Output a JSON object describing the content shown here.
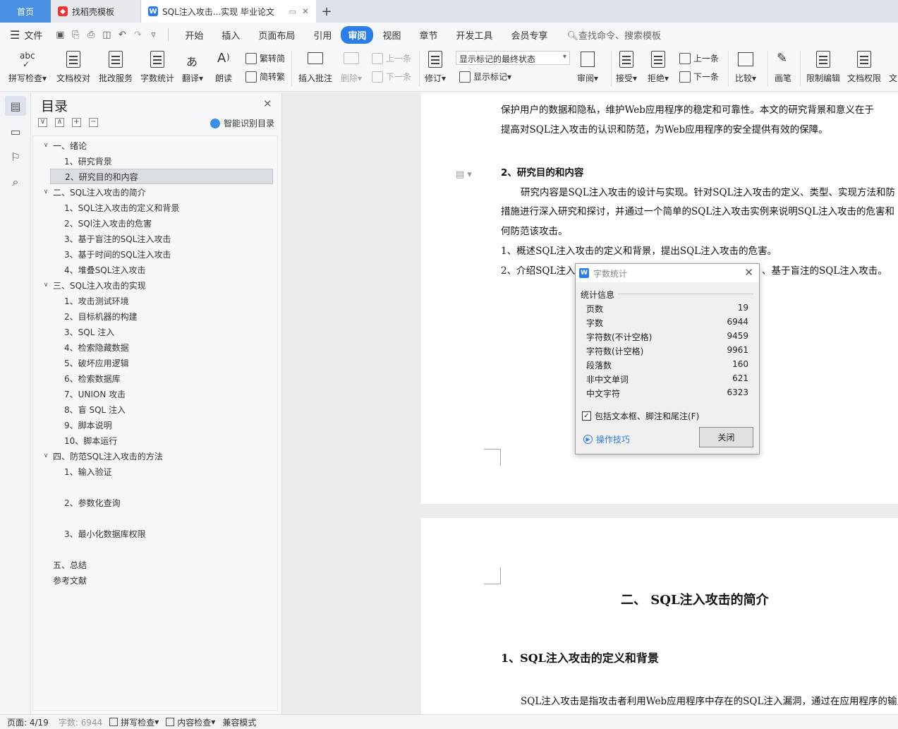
{
  "tabs": {
    "home": "首页",
    "template": "找稻壳模板",
    "doc": "SQL注入攻击...实现 毕业论文"
  },
  "menu": {
    "file": "文件",
    "items": [
      "开始",
      "插入",
      "页面布局",
      "引用",
      "审阅",
      "视图",
      "章节",
      "开发工具",
      "会员专享"
    ],
    "active": "审阅",
    "search": "查找命令、搜索模板"
  },
  "ribbon": {
    "spell": "拼写检查",
    "proof": "文档校对",
    "review_service": "批改服务",
    "word_count": "字数统计",
    "translate": "翻译",
    "read_aloud": "朗读",
    "to_trad": "繁转简",
    "to_simp": "简转繁",
    "insert_comment": "插入批注",
    "delete": "删除",
    "prev": "上一条",
    "next": "下一条",
    "track": "修订",
    "markup_state": "显示标记的最终状态",
    "show_markup": "显示标记",
    "review": "审阅",
    "accept": "接受",
    "reject": "拒绝",
    "prev2": "上一条",
    "next2": "下一条",
    "compare": "比较",
    "pen": "画笔",
    "restrict": "限制编辑",
    "doc_rights": "文档权限",
    "more": "文"
  },
  "toc": {
    "title": "目录",
    "smart": "智能识别目录",
    "items": [
      {
        "text": "一、绪论",
        "level": 0,
        "toggle": "∨"
      },
      {
        "text": "1、研究背景",
        "level": 1
      },
      {
        "text": "2、研究目的和内容",
        "level": 1,
        "selected": true
      },
      {
        "text": "二、SQL注入攻击的简介",
        "level": 0,
        "toggle": "∨"
      },
      {
        "text": "1、SQL注入攻击的定义和背景",
        "level": 1
      },
      {
        "text": "2、SQl注入攻击的危害",
        "level": 1
      },
      {
        "text": "3、基于盲注的SQL注入攻击",
        "level": 1
      },
      {
        "text": "3、基于时间的SQL注入攻击",
        "level": 1
      },
      {
        "text": "4、堆叠SQL注入攻击",
        "level": 1
      },
      {
        "text": "三、SQL注入攻击的实现",
        "level": 0,
        "toggle": "∨"
      },
      {
        "text": "1、攻击测试环境",
        "level": 1
      },
      {
        "text": "2、目标机器的构建",
        "level": 1
      },
      {
        "text": "3、SQL 注入",
        "level": 1
      },
      {
        "text": "4、检索隐藏数据",
        "level": 1
      },
      {
        "text": "5、破坏应用逻辑",
        "level": 1
      },
      {
        "text": "6、检索数据库",
        "level": 1
      },
      {
        "text": "7、UNION 攻击",
        "level": 1
      },
      {
        "text": "8、盲 SQL 注入",
        "level": 1
      },
      {
        "text": "9、脚本说明",
        "level": 1
      },
      {
        "text": "10、脚本运行",
        "level": 1
      },
      {
        "text": "四、防范SQL注入攻击的方法",
        "level": 0,
        "toggle": "∨"
      },
      {
        "text": "1、输入验证",
        "level": 1
      },
      {
        "text": "2、参数化查询",
        "level": 1
      },
      {
        "text": "3、最小化数据库权限",
        "level": 1
      },
      {
        "text": "五、总结",
        "level": 0
      },
      {
        "text": "参考文献",
        "level": 0
      }
    ]
  },
  "doc": {
    "lines_p1": [
      "保护用户的数据和隐私，维护Web应用程序的稳定和可靠性。本文的研究背景和意义在于",
      "提高对SQL注入攻击的认识和防范，为Web应用程序的安全提供有效的保障。",
      "2、研究目的和内容",
      "研究内容是SQL注入攻击的设计与实现。针对SQL注入攻击的定义、类型、实现方法和防",
      "措施进行深入研究和探讨，并通过一个简单的SQL注入攻击实例来说明SQL注入攻击的危害和",
      "何防范该攻击。",
      "1、概述SQL注入攻击的定义和背景，提出SQL注入攻击的危害。",
      "2、介绍SQL注入",
      "、基于盲注的SQL注入攻击。"
    ],
    "chapter": "二、  SQL注入攻击的简介",
    "section": "1、SQL注入攻击的定义和背景",
    "body": "SQL注入攻击是指攻击者利用Web应用程序中存在的SQL注入漏洞，通过在应用程序的输入"
  },
  "dialog": {
    "title": "字数统计",
    "section": "统计信息",
    "stats": [
      {
        "label": "页数",
        "value": "19"
      },
      {
        "label": "字数",
        "value": "6944"
      },
      {
        "label": "字符数(不计空格)",
        "value": "9459"
      },
      {
        "label": "字符数(计空格)",
        "value": "9961"
      },
      {
        "label": "段落数",
        "value": "160"
      },
      {
        "label": "非中文单词",
        "value": "621"
      },
      {
        "label": "中文字符",
        "value": "6323"
      }
    ],
    "checkbox": "包括文本框、脚注和尾注(F)",
    "tips": "操作技巧",
    "close": "关闭"
  },
  "status": {
    "page": "页面: 4/19",
    "words": "字数: 6944",
    "spell": "拼写检查",
    "content": "内容检查",
    "compat": "兼容模式"
  }
}
